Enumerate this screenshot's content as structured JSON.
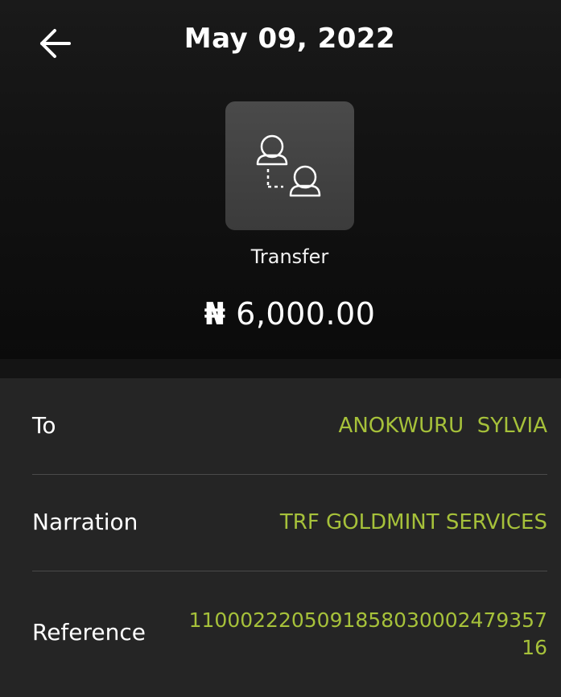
{
  "header": {
    "title": "May 09, 2022",
    "back_icon": "arrow-left-icon",
    "transaction_type": "Transfer",
    "transaction_icon": "user-transfer-icon",
    "currency_symbol": "₦",
    "amount": "6,000.00"
  },
  "details": [
    {
      "label": "To",
      "value": "ANOKWURU  SYLVIA"
    },
    {
      "label": "Narration",
      "value": "TRF GOLDMINT SERVICES"
    },
    {
      "label": "Reference",
      "value": "110002220509185803000247935716"
    }
  ],
  "colors": {
    "accent": "#a6c13a",
    "background": "#111111",
    "card": "#252525",
    "tile": "#3e3e3e"
  }
}
